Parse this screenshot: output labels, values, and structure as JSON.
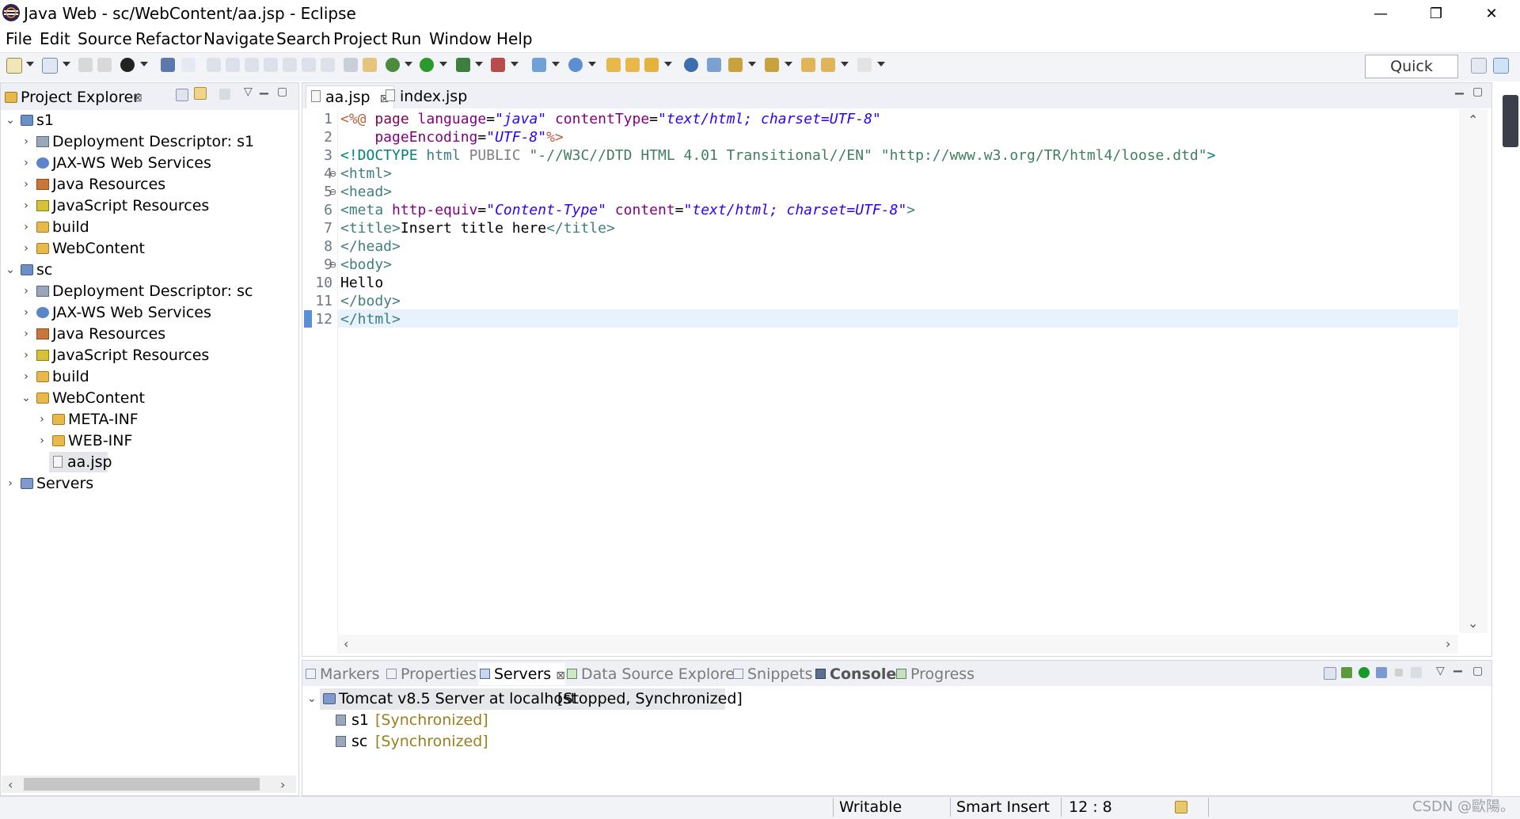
{
  "window": {
    "title": "Java Web - sc/WebContent/aa.jsp - Eclipse",
    "minimize_glyph": "—",
    "restore_glyph": "❐",
    "close_glyph": "✕"
  },
  "menu": [
    "File",
    "Edit",
    "Source",
    "Refactor",
    "Navigate",
    "Search",
    "Project",
    "Run",
    "Window",
    "Help"
  ],
  "toolbar": {
    "quick_access_label": "Quick Access"
  },
  "explorer": {
    "title": "Project Explorer",
    "close_glyph": "⊠",
    "rows": [
      {
        "label": "s1",
        "twisty": "⌄"
      },
      {
        "label": "Deployment Descriptor: s1",
        "twisty": "›"
      },
      {
        "label": "JAX-WS Web Services",
        "twisty": "›"
      },
      {
        "label": "Java Resources",
        "twisty": "›"
      },
      {
        "label": "JavaScript Resources",
        "twisty": "›"
      },
      {
        "label": "build",
        "twisty": "›"
      },
      {
        "label": "WebContent",
        "twisty": "›"
      },
      {
        "label": "sc",
        "twisty": "⌄"
      },
      {
        "label": "Deployment Descriptor: sc",
        "twisty": "›"
      },
      {
        "label": "JAX-WS Web Services",
        "twisty": "›"
      },
      {
        "label": "Java Resources",
        "twisty": "›"
      },
      {
        "label": "JavaScript Resources",
        "twisty": "›"
      },
      {
        "label": "build",
        "twisty": "›"
      },
      {
        "label": "WebContent",
        "twisty": "⌄"
      },
      {
        "label": "META-INF",
        "twisty": "›"
      },
      {
        "label": "WEB-INF",
        "twisty": "›"
      },
      {
        "label": "aa.jsp",
        "twisty": ""
      },
      {
        "label": "Servers",
        "twisty": "›"
      }
    ]
  },
  "editor": {
    "tabs": [
      {
        "label": "aa.jsp",
        "close": "⊠"
      },
      {
        "label": "index.jsp"
      }
    ],
    "lines": [
      {
        "n": "1",
        "fold": ""
      },
      {
        "n": "2",
        "fold": ""
      },
      {
        "n": "3",
        "fold": ""
      },
      {
        "n": "4",
        "fold": "⊖"
      },
      {
        "n": "5",
        "fold": "⊖"
      },
      {
        "n": "6",
        "fold": ""
      },
      {
        "n": "7",
        "fold": ""
      },
      {
        "n": "8",
        "fold": ""
      },
      {
        "n": "9",
        "fold": "⊖"
      },
      {
        "n": "10",
        "fold": ""
      },
      {
        "n": "11",
        "fold": ""
      },
      {
        "n": "12",
        "fold": ""
      }
    ],
    "code": {
      "l1_open": "<%@",
      "l1_kw": " page ",
      "l1_a1": "language",
      "l1_eq": "=",
      "l1_v1": "\"java\"",
      "l1_a2": " contentType",
      "l1_v2": "\"text/html; charset=UTF-8\"",
      "l2_a": "    pageEncoding",
      "l2_v": "\"UTF-8\"",
      "l2_close": "%>",
      "l3_a": "<!DOCTYPE ",
      "l3_b": "html",
      "l3_c": " PUBLIC ",
      "l3_d": "\"-//W3C//DTD HTML 4.01 Transitional//EN\"",
      "l3_e": " \"http://www.w3.org/TR/html4/loose.dtd\"",
      "l3_f": ">",
      "l4": "<html>",
      "l5": "<head>",
      "l6_open": "<meta",
      "l6_a1": " http-equiv",
      "l6_v1": "\"Content-Type\"",
      "l6_a2": " content",
      "l6_v2": "\"text/html; charset=UTF-8\"",
      "l6_close": ">",
      "l7_open": "<title>",
      "l7_text": "Insert title here",
      "l7_close": "</title>",
      "l8": "</head>",
      "l9": "<body>",
      "l10": "Hello",
      "l11": "</body>",
      "l12": "</html>"
    }
  },
  "servers_panel": {
    "tabs": [
      {
        "label": "Markers"
      },
      {
        "label": "Properties"
      },
      {
        "label": "Servers",
        "close": "⊠"
      },
      {
        "label": "Data Source Explorer"
      },
      {
        "label": "Snippets"
      },
      {
        "label": "Console"
      },
      {
        "label": "Progress"
      }
    ],
    "server": {
      "name": "Tomcat v8.5 Server at localhost",
      "state": "[Stopped, Synchronized]",
      "twisty": "⌄"
    },
    "modules": [
      {
        "name": "s1",
        "state": "[Synchronized]"
      },
      {
        "name": "sc",
        "state": "[Synchronized]"
      }
    ]
  },
  "status": {
    "writable": "Writable",
    "insert_mode": "Smart Insert",
    "position": "12 : 8"
  },
  "watermark": "CSDN @歐陽。",
  "colors": {
    "tag": "#3f7f7f",
    "attr": "#7f007f",
    "string": "#2a00ff",
    "sync": "#9b7f1f"
  }
}
